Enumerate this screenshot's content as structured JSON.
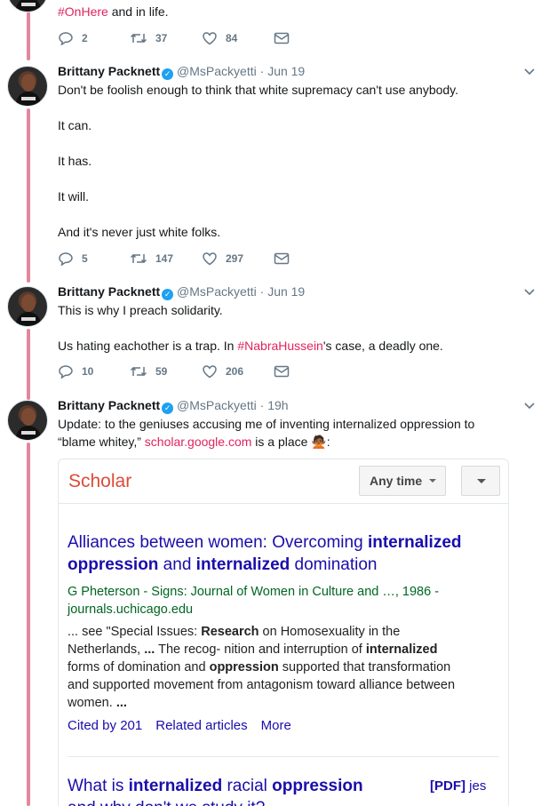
{
  "tweet0": {
    "text_hashtag": "#OnHere",
    "text_rest": " and in life.",
    "replies": "2",
    "retweets": "37",
    "likes": "84"
  },
  "tweets": [
    {
      "name": "Brittany Packnett",
      "handle": "@MsPackyetti",
      "time": "Jun 19",
      "lines": [
        "Don't be foolish enough to think that white supremacy can't use anybody.",
        "It can.",
        "It has.",
        "It will.",
        "And it's never just white folks."
      ],
      "replies": "5",
      "retweets": "147",
      "likes": "297"
    },
    {
      "name": "Brittany Packnett",
      "handle": "@MsPackyetti",
      "time": "Jun 19",
      "line1": "This is why I preach solidarity.",
      "line2_pre": "Us hating eachother is a trap. In ",
      "line2_hashtag": "#NabraHussein",
      "line2_post": "'s case, a deadly one.",
      "replies": "10",
      "retweets": "59",
      "likes": "206"
    },
    {
      "name": "Brittany Packnett",
      "handle": "@MsPackyetti",
      "time": "19h",
      "line1": "Update: to the geniuses accusing me of inventing internalized oppression to",
      "line2_pre": "“blame whitey,” ",
      "line2_link": "scholar.google.com",
      "line2_post": " is a place ",
      "emoji": "🙅🏾",
      "line2_end": ":"
    }
  ],
  "dot": "·",
  "scholar": {
    "logo": "Scholar",
    "anytime": "Any time",
    "result1": {
      "title_a": "Alliances between women: Overcoming ",
      "title_b": "internalized",
      "title_c": "oppression",
      "title_d": " and ",
      "title_e": "internalized",
      "title_f": " domination",
      "meta1": "G Pheterson - Signs: Journal of Women in Culture and …, 1986 -",
      "meta2": "journals.uchicago.edu",
      "snip1a": "... see \"Special Issues: ",
      "snip1b": "Research",
      "snip1c": " on Homosexuality in the",
      "snip2a": "Netherlands, ",
      "snip2b": "...",
      "snip2c": " The recog- nition and interruption of ",
      "snip2d": "internalized",
      "snip3a": "forms of domination and ",
      "snip3b": "oppression",
      "snip3c": " supported that transformation",
      "snip4": "and supported movement from antagonism toward alliance between",
      "snip5a": "women. ",
      "snip5b": "...",
      "cited": "Cited by 201",
      "related": "Related articles",
      "more": "More"
    },
    "result2": {
      "title_a": "What is ",
      "title_b": "internalized",
      "title_c": " racial ",
      "title_d": "oppression",
      "title_e": "and why don't we study it?",
      "pdf_tag": "[PDF]",
      "pdf_src": " jes"
    }
  }
}
